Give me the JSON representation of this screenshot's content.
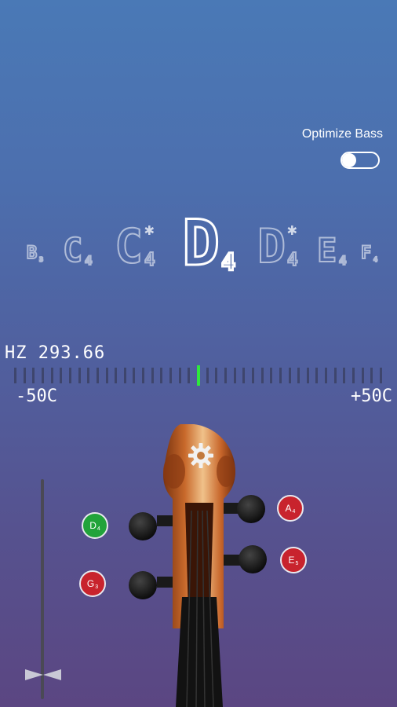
{
  "settings": {
    "optimize_bass_label": "Optimize Bass",
    "optimize_bass_on": false
  },
  "notes": [
    {
      "name": "B",
      "octave": "3",
      "sharp": false,
      "active": false
    },
    {
      "name": "C",
      "octave": "4",
      "sharp": false,
      "active": false
    },
    {
      "name": "C",
      "octave": "4",
      "sharp": true,
      "active": false
    },
    {
      "name": "D",
      "octave": "4",
      "sharp": false,
      "active": true
    },
    {
      "name": "D",
      "octave": "4",
      "sharp": true,
      "active": false
    },
    {
      "name": "E",
      "octave": "4",
      "sharp": false,
      "active": false
    },
    {
      "name": "F",
      "octave": "4",
      "sharp": false,
      "active": false
    }
  ],
  "meter": {
    "frequency_label": "HZ 293.66",
    "min_label": "-50C",
    "max_label": "+50C",
    "cents_offset": 0
  },
  "strings": [
    {
      "note": "D",
      "octave": "4",
      "selected": true
    },
    {
      "note": "G",
      "octave": "3",
      "selected": false
    },
    {
      "note": "A",
      "octave": "4",
      "selected": false
    },
    {
      "note": "E",
      "octave": "5",
      "selected": false
    }
  ],
  "colors": {
    "accent_green": "#2ee83d",
    "string_red": "#c8232d",
    "string_green": "#21a33a"
  },
  "icons": {
    "settings": "gear-icon",
    "slider": "bowtie-handle-icon"
  }
}
